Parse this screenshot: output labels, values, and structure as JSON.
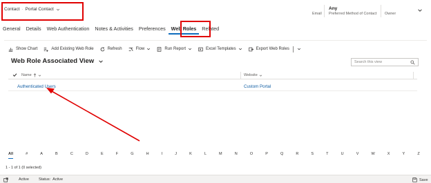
{
  "header": {
    "breadcrumb": [
      "Contact",
      "Portal Contact"
    ],
    "email_value": "",
    "email_label": "Email",
    "method_value": "Any",
    "method_label": "Preferred Method of Contact",
    "owner_label": "Owner"
  },
  "tabs": [
    {
      "label": "General"
    },
    {
      "label": "Details"
    },
    {
      "label": "Web Authentication"
    },
    {
      "label": "Notes & Activities"
    },
    {
      "label": "Preferences"
    },
    {
      "label": "Web Roles",
      "active": true
    },
    {
      "label": "Related"
    }
  ],
  "toolbar": {
    "show_chart": "Show Chart",
    "add_existing": "Add Existing Web Role",
    "refresh": "Refresh",
    "flow": "Flow",
    "run_report": "Run Report",
    "excel_templates": "Excel Templates",
    "export": "Export Web Roles"
  },
  "view": {
    "title": "Web Role Associated View",
    "search_placeholder": "Search this view"
  },
  "grid": {
    "columns": [
      "Name",
      "Website"
    ],
    "rows": [
      {
        "name": "Authenticated Users",
        "website": "Custom Portal"
      }
    ]
  },
  "alphabet": [
    "All",
    "#",
    "A",
    "B",
    "C",
    "D",
    "E",
    "F",
    "G",
    "H",
    "I",
    "J",
    "K",
    "L",
    "M",
    "N",
    "O",
    "P",
    "Q",
    "R",
    "S",
    "T",
    "U",
    "V",
    "W",
    "X",
    "Y",
    "Z"
  ],
  "footer": {
    "count_text": "1 - 1 of 1 (0 selected)"
  },
  "statusbar": {
    "active": "Active",
    "status_label": "Status:",
    "status_value": "Active",
    "save": "Save"
  },
  "colors": {
    "annotation": "#e00000",
    "accent": "#0f6cbd",
    "link": "#115ea3"
  }
}
